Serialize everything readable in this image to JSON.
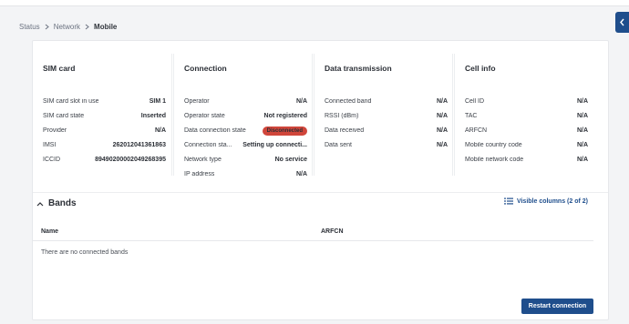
{
  "breadcrumb": [
    "Status",
    "Network",
    "Mobile"
  ],
  "sections": [
    {
      "title": "SIM card",
      "rows": [
        {
          "label": "SIM card slot in use",
          "value": "SIM 1"
        },
        {
          "label": "SIM card state",
          "value": "Inserted"
        },
        {
          "label": "Provider",
          "value": "N/A"
        },
        {
          "label": "IMSI",
          "value": "262012041361863"
        },
        {
          "label": "ICCID",
          "value": "89490200002049268395"
        }
      ]
    },
    {
      "title": "Connection",
      "rows": [
        {
          "label": "Operator",
          "value": "N/A"
        },
        {
          "label": "Operator state",
          "value": "Not registered"
        },
        {
          "label": "Data connection state",
          "value": "Disconnected",
          "badge": true
        },
        {
          "label": "Connection sta...",
          "value": "Setting up connecti..."
        },
        {
          "label": "Network type",
          "value": "No service"
        },
        {
          "label": "IP address",
          "value": "N/A"
        }
      ]
    },
    {
      "title": "Data transmission",
      "rows": [
        {
          "label": "Connected band",
          "value": "N/A"
        },
        {
          "label": "RSSI (dBm)",
          "value": "N/A"
        },
        {
          "label": "Data received",
          "value": "N/A"
        },
        {
          "label": "Data sent",
          "value": "N/A"
        }
      ]
    },
    {
      "title": "Cell info",
      "rows": [
        {
          "label": "Cell ID",
          "value": "N/A"
        },
        {
          "label": "TAC",
          "value": "N/A"
        },
        {
          "label": "ARFCN",
          "value": "N/A"
        },
        {
          "label": "Mobile country code",
          "value": "N/A"
        },
        {
          "label": "Mobile network code",
          "value": "N/A"
        }
      ]
    }
  ],
  "bands": {
    "title": "Bands",
    "visible_columns": "Visible columns (2 of 2)",
    "columns": [
      "Name",
      "ARFCN"
    ],
    "empty_message": "There are no connected bands"
  },
  "restart_button": "Restart connection",
  "colors": {
    "accent": "#1f4e8c",
    "danger": "#d0463b"
  }
}
